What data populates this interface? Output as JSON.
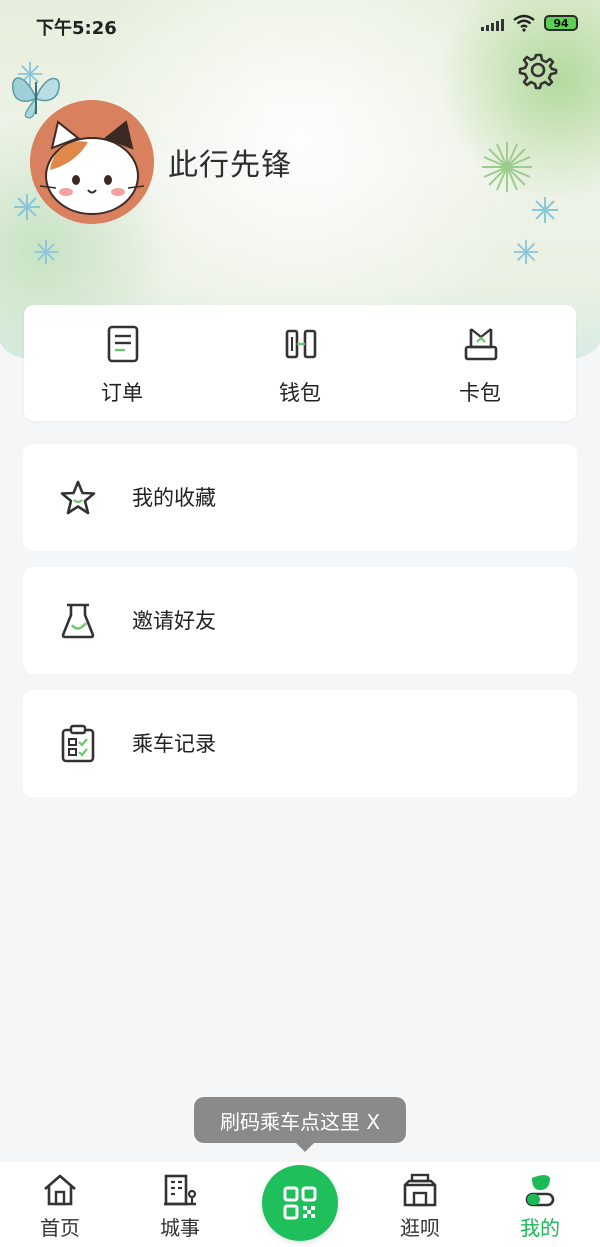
{
  "status_bar": {
    "time": "下午5:26",
    "battery": "94"
  },
  "profile": {
    "username": "此行先锋"
  },
  "quick_actions": [
    {
      "label": "订单",
      "icon": "order-icon"
    },
    {
      "label": "钱包",
      "icon": "wallet-icon"
    },
    {
      "label": "卡包",
      "icon": "card-pack-icon"
    }
  ],
  "menu": [
    {
      "label": "我的收藏",
      "icon": "star-icon"
    },
    {
      "label": "邀请好友",
      "icon": "invite-flask-icon"
    },
    {
      "label": "乘车记录",
      "icon": "clipboard-icon"
    }
  ],
  "tooltip": {
    "text": "刷码乘车点这里 X"
  },
  "tabbar": [
    {
      "label": "首页",
      "icon": "home-icon"
    },
    {
      "label": "城事",
      "icon": "city-icon"
    },
    {
      "label": "",
      "icon": "qr-scan-icon"
    },
    {
      "label": "逛呗",
      "icon": "shop-icon"
    },
    {
      "label": "我的",
      "icon": "profile-icon",
      "active": true
    }
  ],
  "colors": {
    "accent_green": "#1fbf5c",
    "active_tab": "#1db954",
    "tooltip_bg": "#8a8a8a",
    "icon_green": "#6bc76a"
  }
}
